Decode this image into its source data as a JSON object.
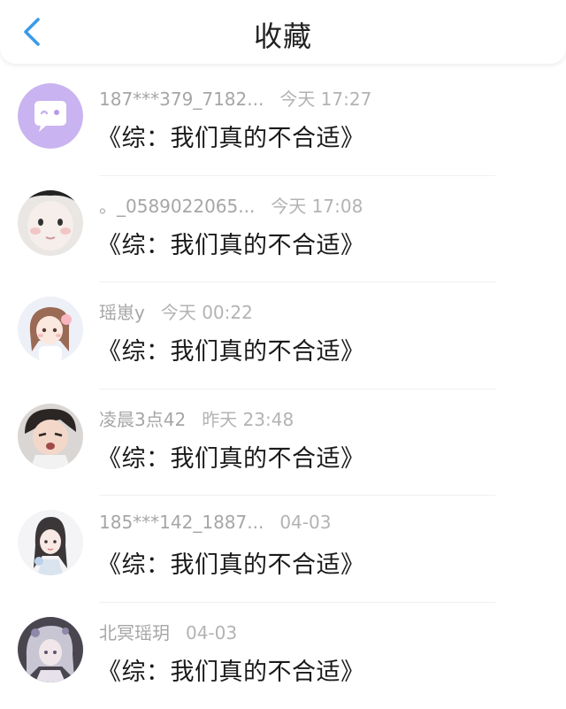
{
  "header": {
    "title": "收藏",
    "back_icon": "chevron-left-icon",
    "accent": "#3a9be8"
  },
  "favorites": [
    {
      "user": "187***379_7182...",
      "time": "今天 17:27",
      "book": "《综：我们真的不合适》",
      "avatar": "chat-bubble-icon"
    },
    {
      "user": "。_0589022065...",
      "time": "今天 17:08",
      "book": "《综：我们真的不合适》",
      "avatar": "baby-face"
    },
    {
      "user": "瑶崽y",
      "time": "今天 00:22",
      "book": "《综：我们真的不合适》",
      "avatar": "anime-girl"
    },
    {
      "user": "凌晨3点42",
      "time": "昨天 23:48",
      "book": "《综：我们真的不合适》",
      "avatar": "anime-boy"
    },
    {
      "user": "185***142_1887...",
      "time": "04-03",
      "book": "《综：我们真的不合适》",
      "avatar": "drawn-girl"
    },
    {
      "user": "北冥瑶玥",
      "time": "04-03",
      "book": "《综：我们真的不合适》",
      "avatar": "silver-hair-girl"
    }
  ]
}
